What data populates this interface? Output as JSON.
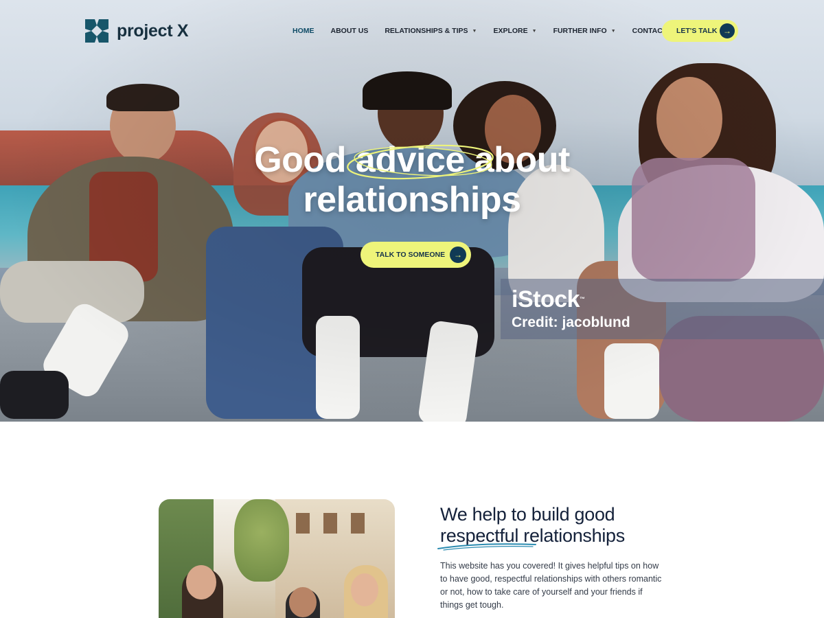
{
  "brand": {
    "name": "project X"
  },
  "nav": {
    "items": [
      {
        "label": "HOME",
        "active": true,
        "dropdown": false
      },
      {
        "label": "ABOUT US",
        "active": false,
        "dropdown": false
      },
      {
        "label": "RELATIONSHIPS & TIPS",
        "active": false,
        "dropdown": true
      },
      {
        "label": "EXPLORE",
        "active": false,
        "dropdown": true
      },
      {
        "label": "FURTHER INFO",
        "active": false,
        "dropdown": true
      },
      {
        "label": "CONTACT",
        "active": false,
        "dropdown": false
      }
    ],
    "cta_label": "LET'S TALK"
  },
  "hero": {
    "title_line1": "Good advice about",
    "title_line2": "relationships",
    "cta_label": "TALK TO SOMEONE",
    "watermark_brand": "iStock",
    "watermark_tm": "™",
    "watermark_credit": "Credit: jacoblund"
  },
  "section": {
    "title_line1": "We help to build good",
    "title_highlight": "respectful",
    "title_line2_rest": " relationships",
    "body": "This website has you covered! It gives helpful tips on how to have good, respectful relationships with others romantic or not, how to take care of yourself and your friends if things get tough."
  },
  "colors": {
    "accent_yellow": "#eef47a",
    "brand_dark": "#103a55",
    "brand_teal": "#17566a",
    "underline_blue": "#2b8bb0"
  },
  "icons": {
    "arrow": "arrow-right-icon",
    "caret": "chevron-down-icon",
    "logo": "logo-mark-icon"
  }
}
